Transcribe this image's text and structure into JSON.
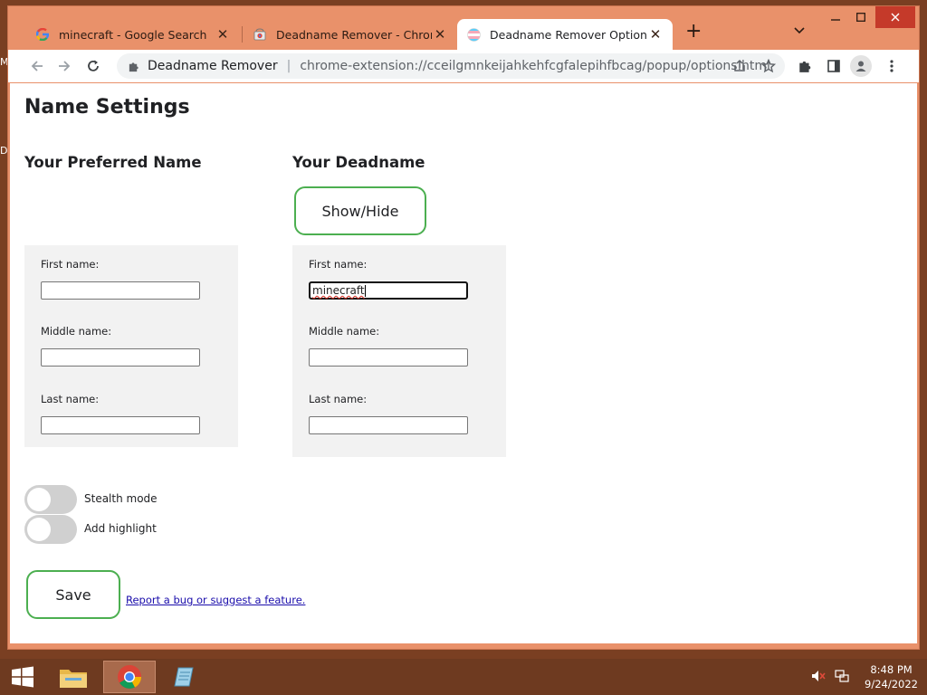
{
  "desktop": {
    "edge_glyph_1": "M",
    "edge_glyph_2": "D"
  },
  "browser": {
    "tabs": [
      {
        "title": "minecraft - Google Search",
        "favicon": "google-icon",
        "active": false
      },
      {
        "title": "Deadname Remover - Chrome W",
        "favicon": "chrome-webstore-icon",
        "active": false
      },
      {
        "title": "Deadname Remover Options",
        "favicon": "trans-flag-icon",
        "active": true
      }
    ],
    "new_tab_label": "+",
    "omnibox": {
      "site_name": "Deadname Remover",
      "separator": "|",
      "url": "chrome-extension://cceilgmnkeijahkehfcgfalepihfbcag/popup/options.html"
    }
  },
  "page": {
    "title": "Name Settings",
    "preferred": {
      "heading": "Your Preferred Name",
      "first_label": "First name:",
      "first_value": "",
      "middle_label": "Middle name:",
      "middle_value": "",
      "last_label": "Last name:",
      "last_value": ""
    },
    "deadname": {
      "heading": "Your Deadname",
      "show_hide_label": "Show/Hide",
      "first_label": "First name:",
      "first_value": "minecraft",
      "middle_label": "Middle name:",
      "middle_value": "",
      "last_label": "Last name:",
      "last_value": ""
    },
    "toggles": [
      {
        "label": "Stealth mode",
        "on": false
      },
      {
        "label": "Add highlight",
        "on": false
      }
    ],
    "save_label": "Save",
    "report_link": "Report a bug or suggest a feature."
  },
  "taskbar": {
    "time": "8:48 PM",
    "date": "9/24/2022"
  },
  "colors": {
    "window_frame": "#e9916a",
    "accent_green": "#4caf50",
    "panel_bg": "#f2f2f2",
    "toggle_off": "#d0d0d0",
    "taskbar": "#6e3a20"
  }
}
